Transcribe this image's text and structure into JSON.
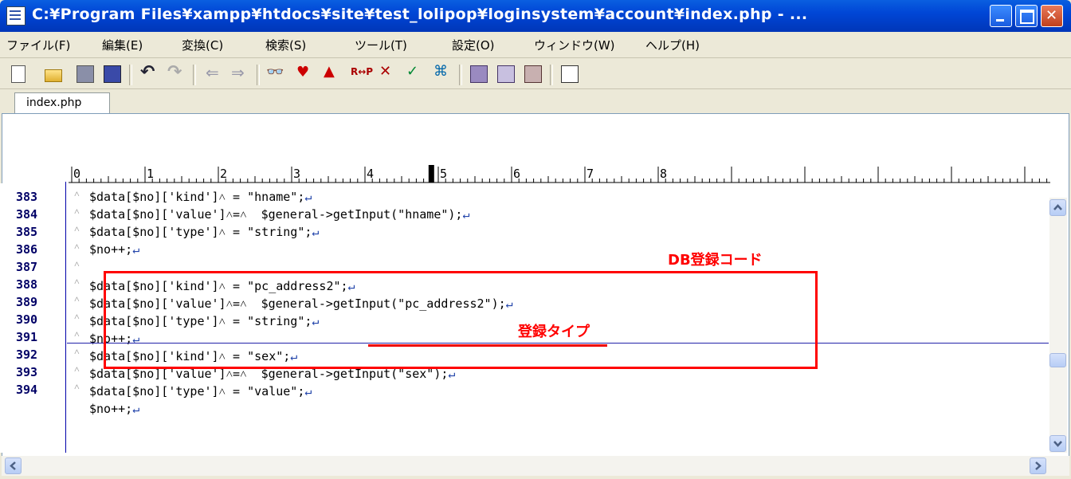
{
  "window": {
    "title": "C:¥Program Files¥xampp¥htdocs¥site¥test_lolipop¥loginsystem¥account¥index.php - ..."
  },
  "menu": [
    "ファイル(F)",
    "編集(E)",
    "変換(C)",
    "検索(S)",
    "ツール(T)",
    "設定(O)",
    "ウィンドウ(W)",
    "ヘルプ(H)"
  ],
  "tab": {
    "label": "index.php"
  },
  "ruler": [
    "0",
    "1",
    "2",
    "3",
    "4",
    "5",
    "6",
    "7",
    "8"
  ],
  "lines": [
    {
      "num": "383",
      "text": "$data[$no]['kind']˄ = \"hname\";",
      "ret": "↵"
    },
    {
      "num": "384",
      "text": "$data[$no]['value']˄=˄  $general->getInput(\"hname\");",
      "ret": "↵"
    },
    {
      "num": "385",
      "text": "$data[$no]['type']˄ = \"string\";",
      "ret": "↵"
    },
    {
      "num": "386",
      "text": "$no++;",
      "ret": "↵"
    },
    {
      "num": "387",
      "text": "$data[$no]['kind']˄ = \"pc_address2\";",
      "ret": "↵"
    },
    {
      "num": "388",
      "text": "$data[$no]['value']˄=˄  $general->getInput(\"pc_address2\");",
      "ret": "↵"
    },
    {
      "num": "389",
      "text": "$data[$no]['type']˄ = \"string\";",
      "ret": "↵"
    },
    {
      "num": "390",
      "text": "$no++;",
      "ret": "↵"
    },
    {
      "num": "391",
      "text": "$data[$no]['kind']˄ = \"sex\";",
      "ret": "↵"
    },
    {
      "num": "392",
      "text": "$data[$no]['value']˄=˄  $general->getInput(\"sex\");",
      "ret": "↵"
    },
    {
      "num": "393",
      "text": "$data[$no]['type']˄ = \"value\";",
      "ret": "↵"
    },
    {
      "num": "394",
      "text": "$no++;",
      "ret": "↵"
    }
  ],
  "tab_marker": "˄",
  "annotations": {
    "db_label": "DB登録コード",
    "type_label": "登録タイプ"
  },
  "colors": {
    "annotation": "#ff0000",
    "titlebar": "#0046d6"
  }
}
